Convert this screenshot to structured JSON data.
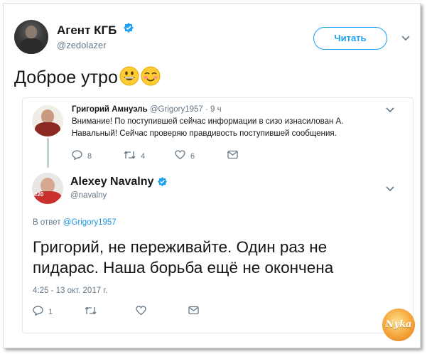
{
  "outer_tweet": {
    "author_name": "Агент КГБ",
    "author_handle": "@zedolazer",
    "follow_label": "Читать",
    "text": "Доброе утро"
  },
  "quoted_thread": {
    "first_tweet": {
      "author_name": "Григорий Амнуэль",
      "author_handle": "@Grigory1957",
      "time": "· 9 ч",
      "text_line1": "Внимание! По поступившей сейчас информации в сизо  изнасилован А.",
      "text_line2": "Навальный! Сейчас проверяю правдивость поступившей сообщения.",
      "reply_count": "8",
      "retweet_count": "4",
      "like_count": "6"
    },
    "reply_tweet": {
      "author_name": "Alexey Navalny",
      "author_handle": "@navalny",
      "reply_prefix": "В ответ",
      "reply_handle": "@Grigory1957",
      "text_line1": "Григорий, не переживайте. Один раз не",
      "text_line2": "пидарас. Наша борьба ещё не окончена",
      "timestamp": "4:25 - 13 окт. 2017 г.",
      "reply_count": "1"
    }
  },
  "watermark": "Nyka",
  "avatar_badge": "#20",
  "colors": {
    "accent": "#1da1f2",
    "text": "#14171a",
    "muted": "#657786"
  },
  "icons": [
    "verified-badge-icon",
    "chevron-down-icon",
    "reply-icon",
    "retweet-icon",
    "like-icon",
    "message-icon",
    "grinning-emoji-icon",
    "blushing-emoji-icon"
  ]
}
